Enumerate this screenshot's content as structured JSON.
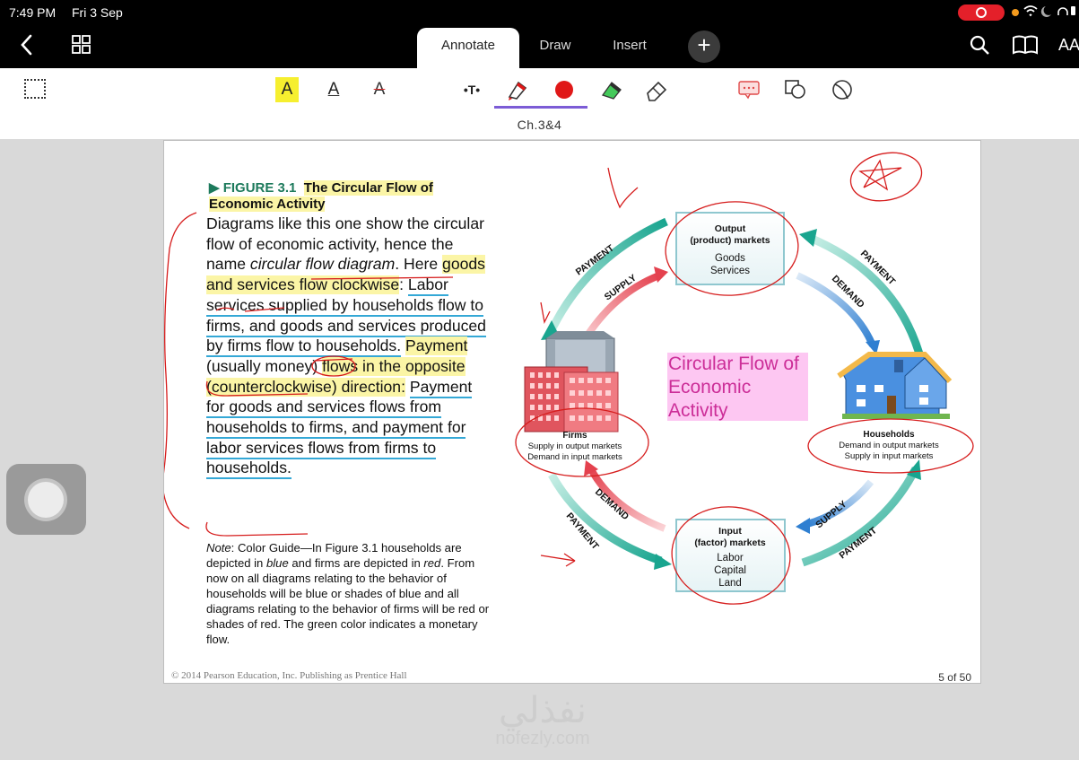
{
  "status_bar": {
    "time": "7:49 PM",
    "date": "Fri 3 Sep"
  },
  "nav": {
    "tabs": [
      {
        "label": "Annotate"
      },
      {
        "label": "Draw"
      },
      {
        "label": "Insert"
      }
    ],
    "add_label": "+",
    "text_size_label": "AA"
  },
  "toolbar": {
    "highlight_glyph": "A",
    "underline_glyph": "A",
    "strike_glyph": "A",
    "text_glyph": "•T•",
    "active_color": "#e01818",
    "active_tool_indicator": "#7c5cd6"
  },
  "document": {
    "title": "Ch.3&4"
  },
  "slide": {
    "figure_label": "▶  FIGURE 3.1",
    "figure_title": "The Circular Flow of Economic Activity",
    "body": [
      {
        "text": "Diagrams like this one show the circular flow of economic activity, hence the name ",
        "style": "plain"
      },
      {
        "text": "circular flow diagram",
        "style": "italic"
      },
      {
        "text": ". Here ",
        "style": "plain"
      },
      {
        "text": "goods and services flow clockwise",
        "style": "highlight"
      },
      {
        "text": ": ",
        "style": "plain"
      },
      {
        "text": "Labor services supplied by households flow to firms, and goods and services produced by firms flow to households.",
        "style": "underline"
      },
      {
        "text": " ",
        "style": "plain"
      },
      {
        "text": "Payment",
        "style": "highlight"
      },
      {
        "text": " (usually money) ",
        "style": "plain"
      },
      {
        "text": "flows in the opposite (counterclockwise) direction:",
        "style": "highlight"
      },
      {
        "text": " ",
        "style": "plain"
      },
      {
        "text": "Payment for goods and services flows from households to firms, and payment for labor services flows from firms to households.",
        "style": "underline"
      }
    ],
    "note": [
      {
        "text": "Note",
        "style": "italic"
      },
      {
        "text": ": Color Guide—In Figure 3.1 households are depicted in ",
        "style": "plain"
      },
      {
        "text": "blue",
        "style": "italic"
      },
      {
        "text": " and firms are depicted in ",
        "style": "plain"
      },
      {
        "text": "red",
        "style": "italic"
      },
      {
        "text": ". From now on all diagrams relating to the behavior of households will be blue or shades of blue and all diagrams relating to the behavior of firms will be red or shades of red. The green color indicates a monetary flow.",
        "style": "plain"
      }
    ],
    "copyright": "© 2014 Pearson Education, Inc. Publishing as Prentice Hall",
    "page_indicator": "5 of 50",
    "diagram": {
      "title": "Circular Flow of Economic Activity",
      "output_market": {
        "title1": "Output",
        "title2": "(product) markets",
        "items": [
          "Goods",
          "Services"
        ]
      },
      "input_market": {
        "title1": "Input",
        "title2": "(factor) markets",
        "items": [
          "Labor",
          "Capital",
          "Land"
        ]
      },
      "firms": {
        "title": "Firms",
        "lines": [
          "Supply in output markets",
          "Demand in input markets"
        ]
      },
      "households": {
        "title": "Households",
        "lines": [
          "Demand in output markets",
          "Supply in input markets"
        ]
      },
      "arrow_labels": {
        "top_left_outer": "PAYMENT",
        "top_left_inner": "SUPPLY",
        "top_right_outer": "PAYMENT",
        "top_right_inner": "DEMAND",
        "bottom_left_inner": "DEMAND",
        "bottom_left_outer": "PAYMENT",
        "bottom_right_inner": "SUPPLY",
        "bottom_right_outer": "PAYMENT"
      }
    }
  },
  "watermark": {
    "arabic": "نفذلي",
    "latin": "nofezly.com"
  }
}
